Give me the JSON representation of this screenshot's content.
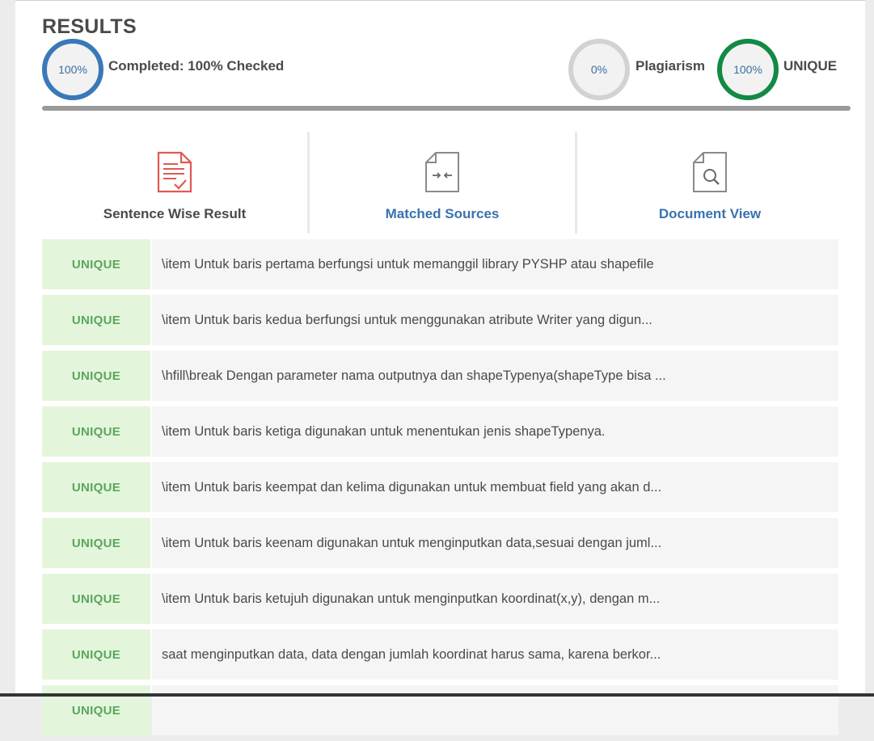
{
  "header": {
    "title": "RESULTS",
    "completed": {
      "percent": "100%",
      "label": "Completed: 100% Checked",
      "color": "#3a79b8"
    },
    "plagiarism": {
      "percent": "0%",
      "label": "Plagiarism",
      "color": "#d2d2d2"
    },
    "unique": {
      "percent": "100%",
      "label": "UNIQUE",
      "color": "#128a44"
    }
  },
  "tabs": [
    {
      "label": "Sentence Wise Result",
      "icon": "document-check-icon",
      "active": true
    },
    {
      "label": "Matched Sources",
      "icon": "document-compare-icon",
      "active": false
    },
    {
      "label": "Document View",
      "icon": "document-search-icon",
      "active": false
    }
  ],
  "rows": [
    {
      "status": "UNIQUE",
      "text": "\\item Untuk baris pertama berfungsi untuk memanggil library PYSHP atau shapefile"
    },
    {
      "status": "UNIQUE",
      "text": "\\item Untuk baris kedua berfungsi untuk menggunakan atribute Writer yang digun..."
    },
    {
      "status": "UNIQUE",
      "text": "\\hfill\\break Dengan parameter nama outputnya dan shapeTypenya(shapeType bisa ..."
    },
    {
      "status": "UNIQUE",
      "text": "\\item Untuk baris ketiga digunakan untuk menentukan jenis shapeTypenya."
    },
    {
      "status": "UNIQUE",
      "text": "\\item Untuk baris keempat dan kelima digunakan untuk membuat field yang akan d..."
    },
    {
      "status": "UNIQUE",
      "text": "\\item Untuk baris keenam digunakan untuk menginputkan data,sesuai dengan juml..."
    },
    {
      "status": "UNIQUE",
      "text": "\\item Untuk baris ketujuh digunakan untuk menginputkan koordinat(x,y), dengan m..."
    },
    {
      "status": "UNIQUE",
      "text": "saat menginputkan data, data dengan jumlah koordinat harus sama, karena berkor..."
    },
    {
      "status": "UNIQUE",
      "text": ""
    }
  ]
}
